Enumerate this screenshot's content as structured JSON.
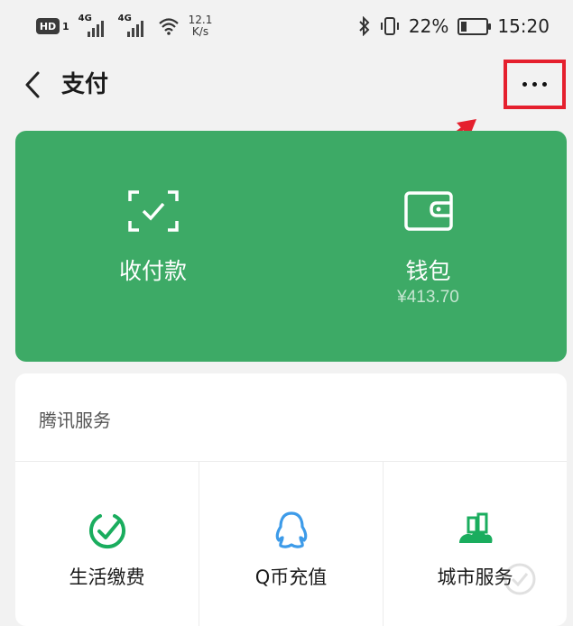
{
  "status_bar": {
    "hd_label": "HD",
    "sim_number": "1",
    "network_1": "4G",
    "network_2": "4G",
    "speed_value": "12.1",
    "speed_unit": "K/s",
    "battery_percent": "22%",
    "battery_level": 0.22,
    "time": "15:20"
  },
  "header": {
    "title": "支付"
  },
  "pay_card": {
    "color": "#3daa66",
    "collect_label": "收付款",
    "wallet_label": "钱包",
    "wallet_balance": "¥413.70"
  },
  "tencent_services": {
    "title": "腾讯服务",
    "items": [
      {
        "label": "生活缴费",
        "icon": "life-payment-icon",
        "color": "#1aad5e"
      },
      {
        "label": "Q币充值",
        "icon": "qq-penguin-icon",
        "color": "#3d9be9"
      },
      {
        "label": "城市服务",
        "icon": "city-services-icon",
        "color": "#1aad5e"
      }
    ]
  },
  "annotation_color": "#e5202e"
}
